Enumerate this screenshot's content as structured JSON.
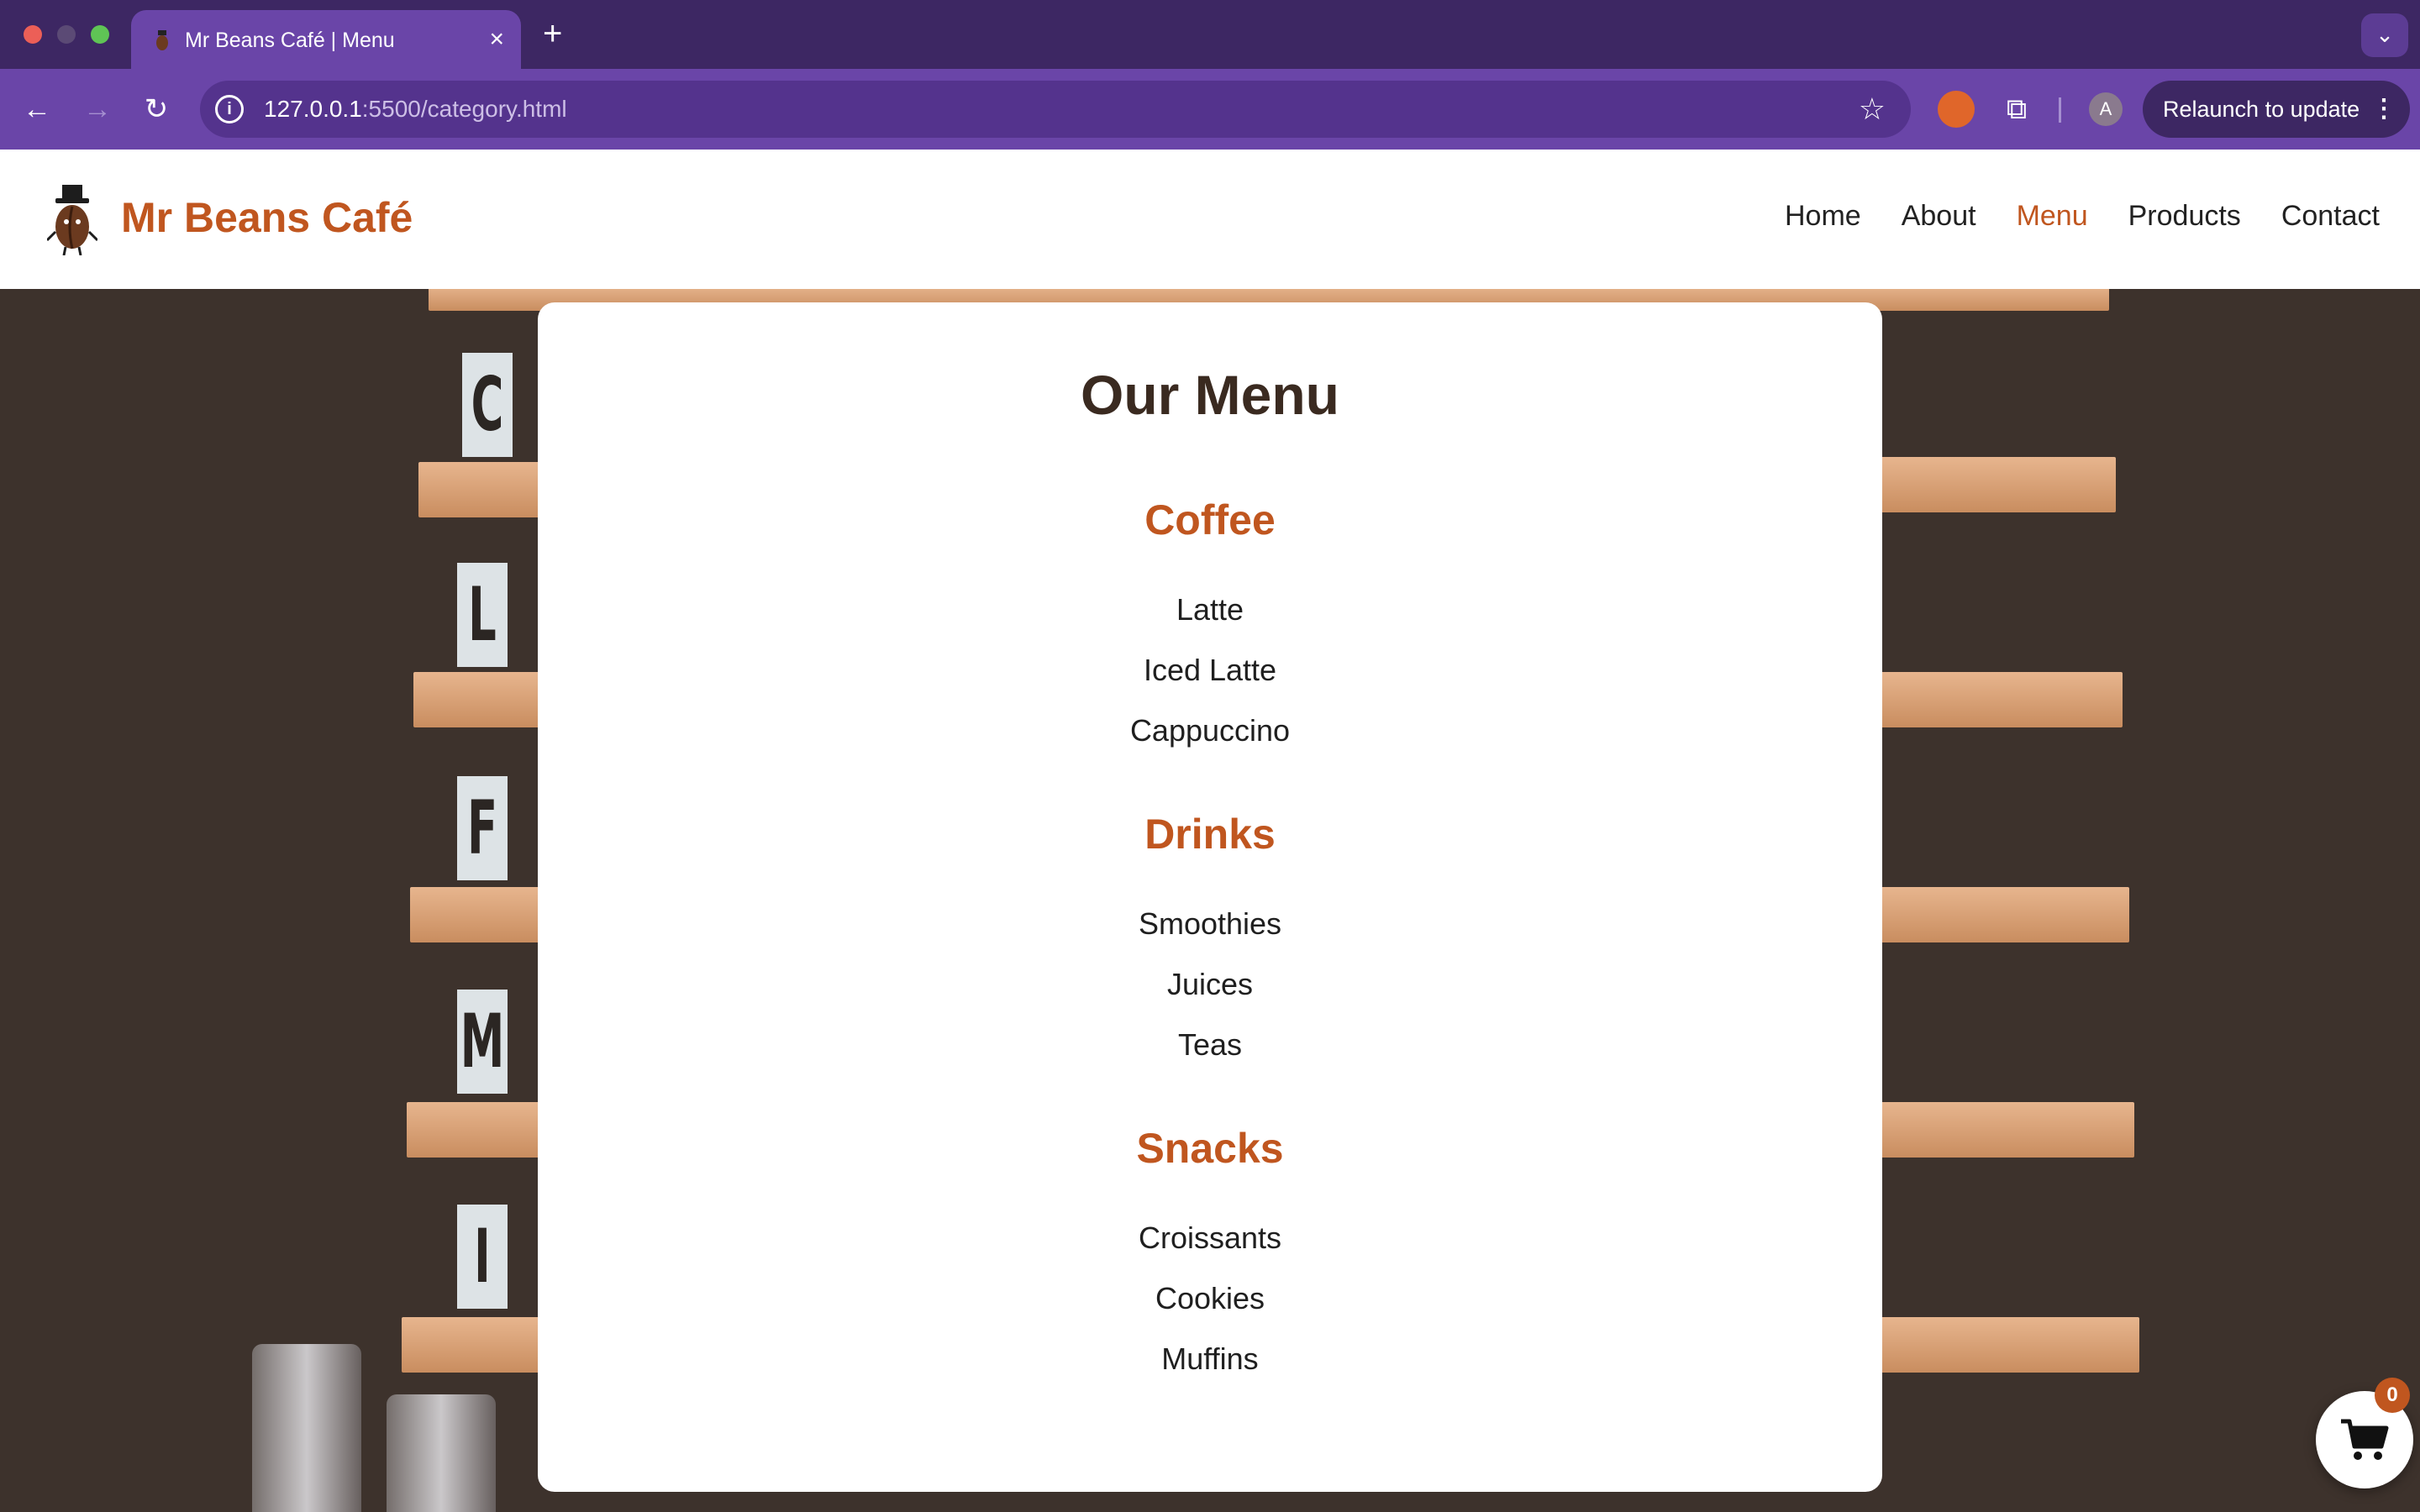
{
  "browser": {
    "tab_title": "Mr Beans Café | Menu",
    "tab_close": "×",
    "new_tab": "+",
    "url_host": "127.0.0.1",
    "url_rest": ":5500/category.html",
    "profile_initial": "A",
    "relaunch_label": "Relaunch to update"
  },
  "site": {
    "brand": "Mr Beans Café",
    "nav": [
      "Home",
      "About",
      "Menu",
      "Products",
      "Contact"
    ],
    "active_nav": "Menu",
    "accent_color": "#c0561f"
  },
  "menu": {
    "title": "Our Menu",
    "categories": [
      {
        "name": "Coffee",
        "items": [
          "Latte",
          "Iced Latte",
          "Cappuccino"
        ]
      },
      {
        "name": "Drinks",
        "items": [
          "Smoothies",
          "Juices",
          "Teas"
        ]
      },
      {
        "name": "Snacks",
        "items": [
          "Croissants",
          "Cookies",
          "Muffins"
        ]
      }
    ]
  },
  "background_letters": [
    "C",
    "L",
    "F",
    "M",
    "I"
  ],
  "cart": {
    "count": "0",
    "icon": "cart-icon"
  }
}
